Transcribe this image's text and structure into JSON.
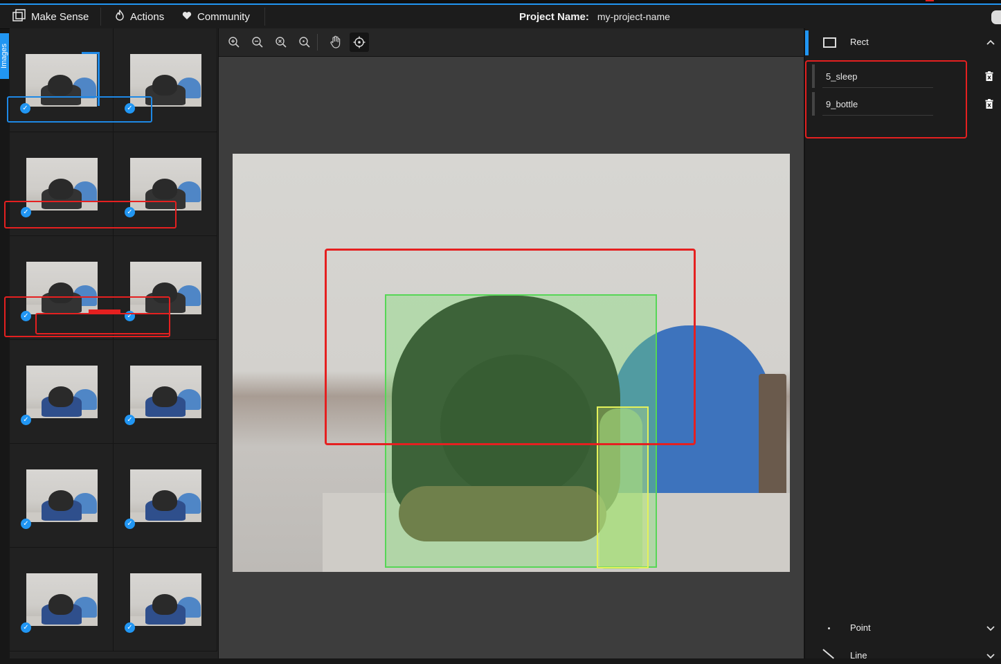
{
  "app": {
    "name": "Make Sense",
    "menu": [
      "Actions",
      "Community"
    ],
    "project_label": "Project Name:",
    "project_name": "my-project-name"
  },
  "sidebar": {
    "tab_label": "Images",
    "thumbnails": 12,
    "checked_icon": "check-circle-icon"
  },
  "toolbar": {
    "tools": [
      "zoom-in-icon",
      "zoom-out-icon",
      "zoom-fit-icon",
      "zoom-max-icon",
      "hand-icon",
      "crosshair-icon"
    ]
  },
  "labels_panel": {
    "rect_title": "Rect",
    "labels": [
      "5_sleep",
      "9_bottle"
    ],
    "point_title": "Point",
    "line_title": "Line"
  },
  "colors": {
    "accent": "#2196f3",
    "annotation_red": "#e52020",
    "bbox_sleep": "#56d656",
    "bbox_bottle": "#e4f25a"
  }
}
